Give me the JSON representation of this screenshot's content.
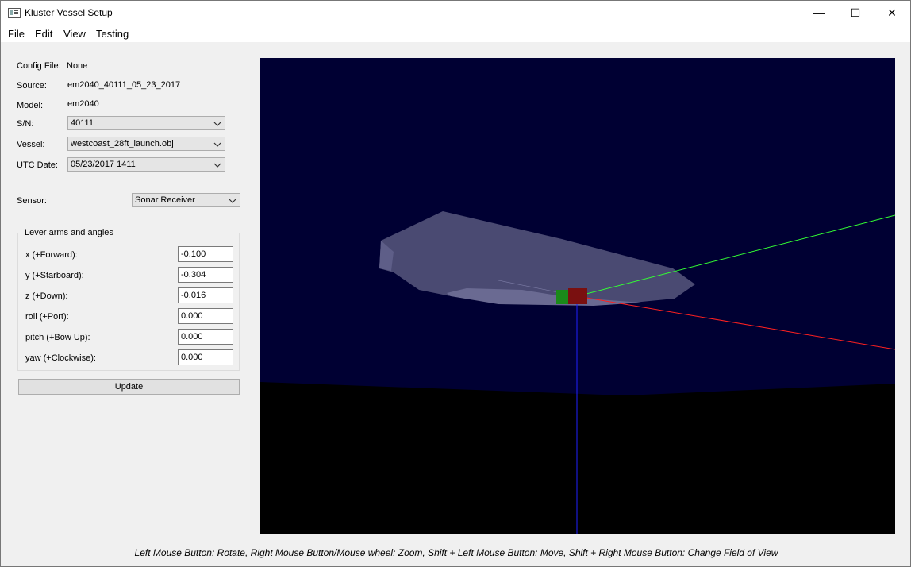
{
  "window": {
    "title": "Kluster Vessel Setup",
    "controls": {
      "minimize": "—",
      "maximize": "☐",
      "close": "✕"
    }
  },
  "menu": [
    "File",
    "Edit",
    "View",
    "Testing"
  ],
  "info": {
    "config_label": "Config File:",
    "config_value": "None",
    "source_label": "Source:",
    "source_value": "em2040_40111_05_23_2017",
    "model_label": "Model:",
    "model_value": "em2040",
    "sn_label": "S/N:",
    "sn_value": "40111",
    "vessel_label": "Vessel:",
    "vessel_value": "westcoast_28ft_launch.obj",
    "utc_label": "UTC Date:",
    "utc_value": "05/23/2017 1411",
    "sensor_label": "Sensor:",
    "sensor_value": "Sonar Receiver"
  },
  "lever": {
    "title": "Lever arms and angles",
    "fields": [
      {
        "label": "x (+Forward):",
        "value": "-0.100"
      },
      {
        "label": "y (+Starboard):",
        "value": "-0.304"
      },
      {
        "label": "z (+Down):",
        "value": "-0.016"
      },
      {
        "label": "roll (+Port):",
        "value": "0.000"
      },
      {
        "label": "pitch (+Bow Up):",
        "value": "0.000"
      },
      {
        "label": "yaw (+Clockwise):",
        "value": "0.000"
      }
    ],
    "update_label": "Update"
  },
  "viewport": {
    "sky_color": "#000033",
    "ground_color": "#000000",
    "hull_color": "#4a4a72",
    "x_axis_color": "#ff2020",
    "y_axis_color": "#33ff33",
    "z_axis_color": "#2020ff"
  },
  "status_text": "Left Mouse Button: Rotate,  Right Mouse Button/Mouse wheel: Zoom,  Shift + Left Mouse Button: Move,  Shift + Right Mouse Button: Change Field of View"
}
